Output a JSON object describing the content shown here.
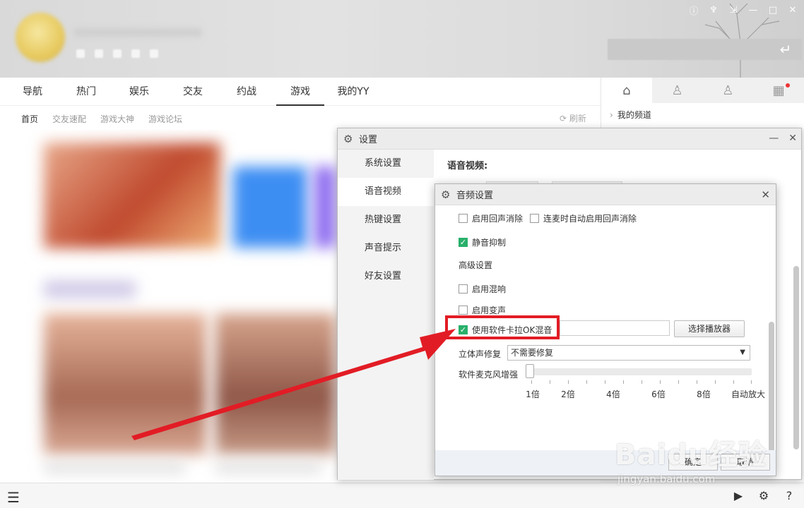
{
  "nav": {
    "items": [
      "导航",
      "热门",
      "娱乐",
      "交友",
      "约战",
      "游戏",
      "我的YY"
    ],
    "active_index": 5
  },
  "subnav": {
    "items": [
      "首页",
      "交友速配",
      "游戏大神",
      "游戏论坛"
    ],
    "refresh_label": "刷新"
  },
  "right_panel": {
    "my_channel": "我的频道"
  },
  "settings_dialog": {
    "title": "设置",
    "side_items": [
      "系统设置",
      "语音视频",
      "热键设置",
      "声音提示",
      "好友设置"
    ],
    "active_side_index": 1,
    "section_title": "语音视频:"
  },
  "audio_dialog": {
    "title": "音频设置",
    "echo_cancel_label": "启用回声消除",
    "auto_echo_label": "连麦时自动启用回声消除",
    "mute_suppress_label": "静音抑制",
    "advanced_label": "高级设置",
    "reverb_label": "启用混响",
    "voice_change_label": "启用变声",
    "karaoke_label": "使用软件卡拉OK混音",
    "choose_player_label": "选择播放器",
    "stereo_fix_label": "立体声修复",
    "stereo_fix_value": "不需要修复",
    "mic_boost_label": "软件麦克风增强",
    "mic_boost_ticks": [
      "1倍",
      "2倍",
      "4倍",
      "6倍",
      "8倍",
      "自动放大"
    ],
    "mic_boost_level": 0,
    "checked": {
      "echo_cancel": false,
      "auto_echo": false,
      "mute_suppress": true,
      "reverb": false,
      "voice_change": false,
      "karaoke": true
    },
    "ok_label": "确定",
    "cancel_label": "取消"
  },
  "watermark": {
    "brand": "Baidu经验",
    "url": "jingyan.baidu.com"
  },
  "colors": {
    "accent_green": "#29b06b",
    "highlight_red": "#e21c25",
    "notification_dot": "#e33"
  }
}
